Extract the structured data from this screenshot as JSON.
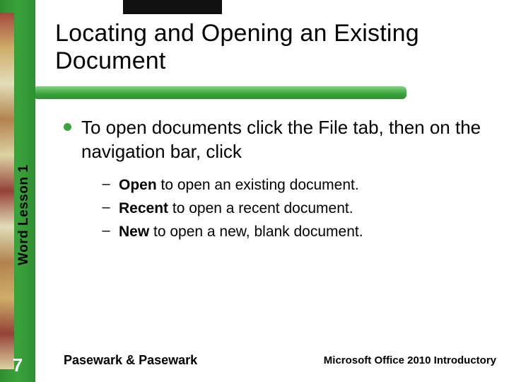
{
  "sidebar": {
    "vertical_label": "Word  Lesson 1",
    "page_number": "7"
  },
  "title": "Locating and Opening an Existing Document",
  "main_bullet": "To open documents click the File tab, then on the navigation bar, click",
  "sub_items": [
    {
      "bold": "Open",
      "rest": " to open an existing document."
    },
    {
      "bold": "Recent",
      "rest": " to open a recent document."
    },
    {
      "bold": "New",
      "rest": " to open a new, blank document."
    }
  ],
  "footer": {
    "left": "Pasewark & Pasewark",
    "right": "Microsoft Office 2010 Introductory"
  }
}
